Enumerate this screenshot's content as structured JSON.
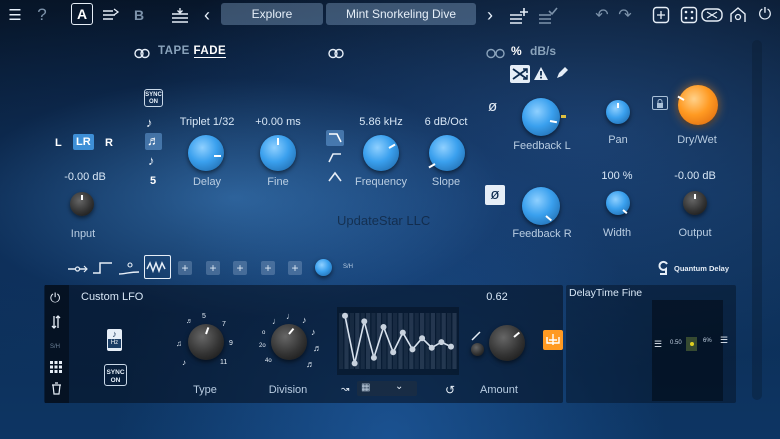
{
  "topbar": {
    "a_label": "A",
    "b_label": "B",
    "preset_category": "Explore",
    "preset_name": "Mint Snorkeling Dive",
    "prev_arrow": "‹",
    "next_arrow": "›"
  },
  "tape": {
    "label_tape": "TAPE",
    "label_fade": "FADE",
    "sync": "SYNC\nON"
  },
  "io": {
    "l": "L",
    "lr": "LR",
    "r": "R",
    "input_value": "-0.00 dB",
    "input_label": "Input"
  },
  "delay": {
    "division_number": "5",
    "delay_value": "Triplet 1/32",
    "delay_label": "Delay",
    "fine_value": "+0.00 ms",
    "fine_label": "Fine"
  },
  "filter": {
    "frequency_value": "5.86 kHz",
    "frequency_label": "Frequency",
    "slope_value": "6 dB/Oct",
    "slope_label": "Slope"
  },
  "feedback": {
    "units_percent": "%",
    "units_dbs": "dB/s",
    "phase_symbol": "ø",
    "feedback_l_label": "Feedback L",
    "feedback_r_label": "Feedback R",
    "pan_label": "Pan",
    "width_value": "100 %",
    "width_label": "Width",
    "drywet_label": "Dry/Wet",
    "output_value": "-0.00 dB",
    "output_label": "Output"
  },
  "watermark": "UpdateStar LLC",
  "modulation": {
    "sh_label": "S/H",
    "brand": "Quantum Delay"
  },
  "lfo": {
    "title": "Custom LFO",
    "sync": "SYNC ON",
    "hz": "Hz",
    "sh_label": "S/H",
    "type_label": "Type",
    "division_label": "Division",
    "amount_value": "0.62",
    "amount_label": "Amount",
    "type_ticks": [
      "5",
      "7",
      "9",
      "11"
    ],
    "division_ticks": [
      "2",
      "2o",
      "4o"
    ],
    "sequence_values": [
      0.95,
      0.1,
      0.85,
      0.2,
      0.75,
      0.3,
      0.65,
      0.35,
      0.55,
      0.38,
      0.48,
      0.4
    ]
  },
  "target": {
    "title": "DelayTime Fine",
    "range_value": "0.50",
    "percent": "6%"
  },
  "colors": {
    "accent_blue": "#3e8fd6",
    "accent_orange": "#ff9a22"
  }
}
